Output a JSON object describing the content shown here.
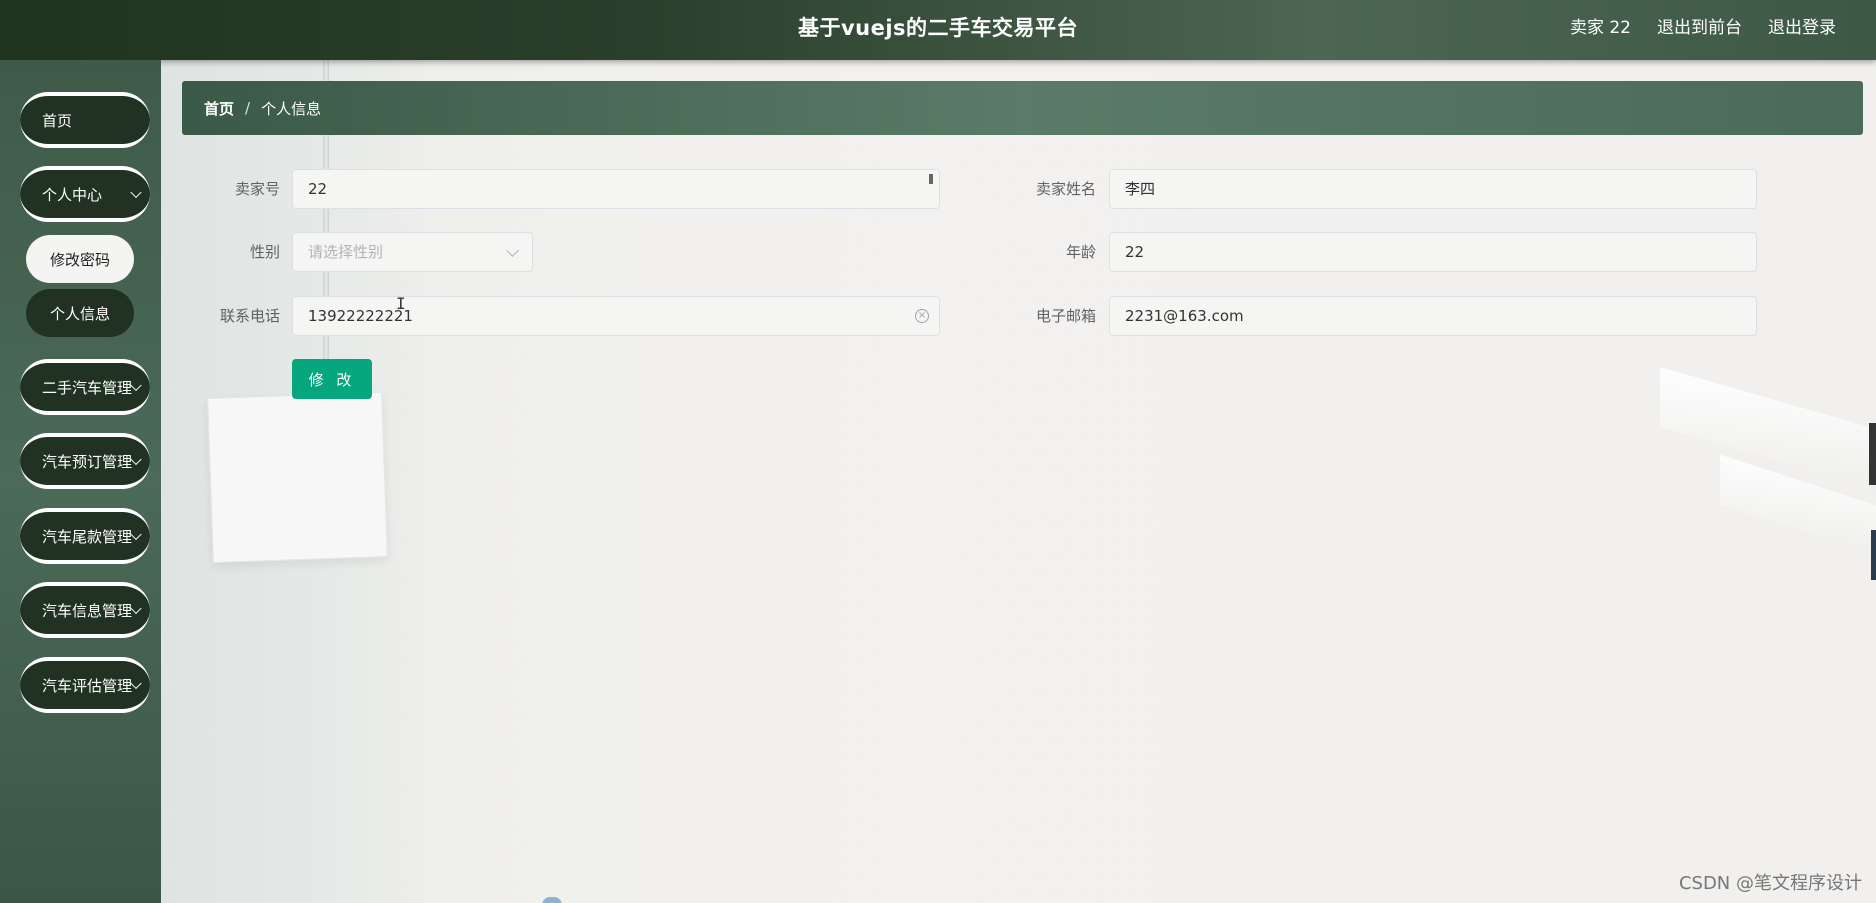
{
  "header": {
    "title": "基于vuejs的二手车交易平台",
    "user_label": "卖家 22",
    "front_link": "退出到前台",
    "logout_link": "退出登录"
  },
  "sidebar": {
    "items": [
      {
        "label": "首页"
      },
      {
        "label": "个人中心"
      },
      {
        "label": "二手汽车管理"
      },
      {
        "label": "汽车预订管理"
      },
      {
        "label": "汽车尾款管理"
      },
      {
        "label": "汽车信息管理"
      },
      {
        "label": "汽车评估管理"
      }
    ],
    "sub_items": [
      {
        "label": "修改密码"
      },
      {
        "label": "个人信息"
      }
    ]
  },
  "breadcrumb": {
    "home": "首页",
    "separator": "/",
    "current": "个人信息"
  },
  "form": {
    "seller_id_label": "卖家号",
    "seller_id_value": "22",
    "seller_name_label": "卖家姓名",
    "seller_name_value": "李四",
    "gender_label": "性别",
    "gender_placeholder": "请选择性别",
    "age_label": "年龄",
    "age_value": "22",
    "phone_label": "联系电话",
    "phone_value": "13922222221",
    "email_label": "电子邮箱",
    "email_value": "2231@163.com",
    "submit_label": "修 改",
    "clear_glyph": "×",
    "cursor_glyph": "I"
  },
  "watermark": "CSDN @笔文程序设计",
  "colors": {
    "primary": "#06a67e",
    "nav_dark": "#213222"
  },
  "icons": {
    "dropdown": "chevron-down-icon",
    "clear": "clear-icon"
  }
}
